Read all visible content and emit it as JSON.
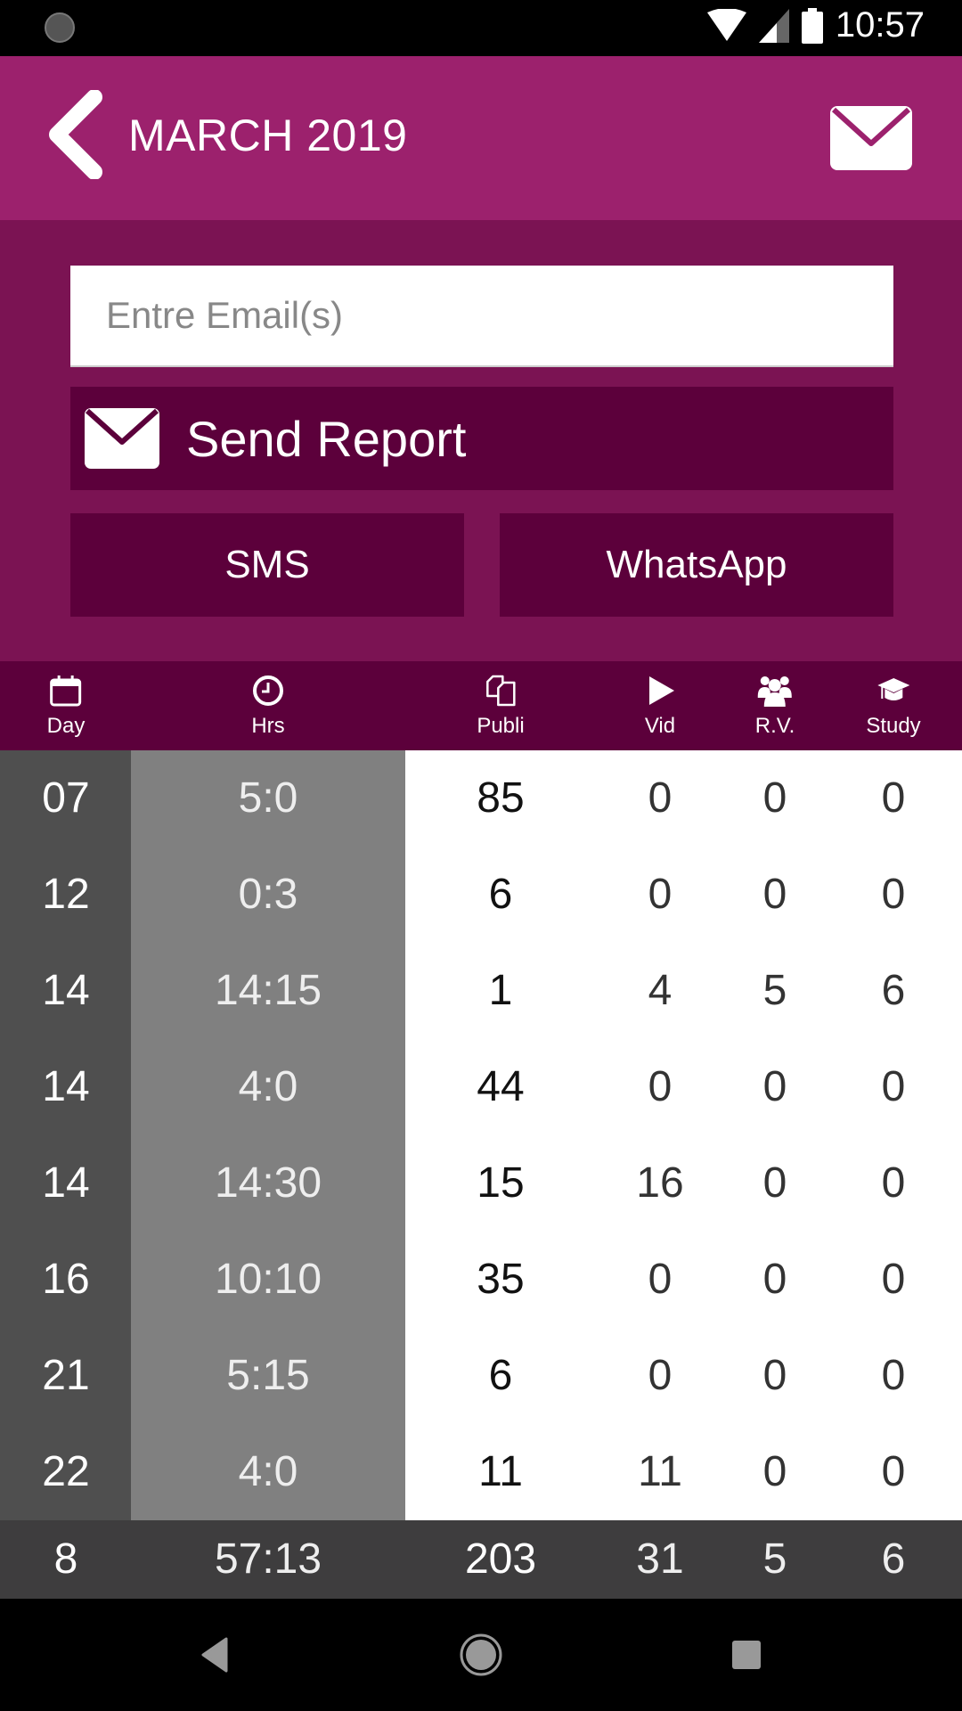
{
  "status_bar": {
    "time": "10:57"
  },
  "header": {
    "title": "MARCH 2019"
  },
  "report": {
    "email_placeholder": "Entre Email(s)",
    "email_value": "",
    "send_label": "Send Report",
    "sms_label": "SMS",
    "whatsapp_label": "WhatsApp"
  },
  "colors": {
    "appbar": "#9c216d",
    "panel": "#7b1353",
    "button": "#5c003b"
  },
  "table": {
    "columns": [
      {
        "key": "day",
        "label": "Day",
        "icon": "calendar-icon"
      },
      {
        "key": "hrs",
        "label": "Hrs",
        "icon": "clock-icon"
      },
      {
        "key": "publi",
        "label": "Publi",
        "icon": "documents-icon"
      },
      {
        "key": "vid",
        "label": "Vid",
        "icon": "play-icon"
      },
      {
        "key": "rv",
        "label": "R.V.",
        "icon": "people-icon"
      },
      {
        "key": "study",
        "label": "Study",
        "icon": "graduation-cap-icon"
      }
    ],
    "rows": [
      {
        "day": "07",
        "hrs": "5:0",
        "publi": "85",
        "vid": "0",
        "rv": "0",
        "study": "0"
      },
      {
        "day": "12",
        "hrs": "0:3",
        "publi": "6",
        "vid": "0",
        "rv": "0",
        "study": "0"
      },
      {
        "day": "14",
        "hrs": "14:15",
        "publi": "1",
        "vid": "4",
        "rv": "5",
        "study": "6"
      },
      {
        "day": "14",
        "hrs": "4:0",
        "publi": "44",
        "vid": "0",
        "rv": "0",
        "study": "0"
      },
      {
        "day": "14",
        "hrs": "14:30",
        "publi": "15",
        "vid": "16",
        "rv": "0",
        "study": "0"
      },
      {
        "day": "16",
        "hrs": "10:10",
        "publi": "35",
        "vid": "0",
        "rv": "0",
        "study": "0"
      },
      {
        "day": "21",
        "hrs": "5:15",
        "publi": "6",
        "vid": "0",
        "rv": "0",
        "study": "0"
      },
      {
        "day": "22",
        "hrs": "4:0",
        "publi": "11",
        "vid": "11",
        "rv": "0",
        "study": "0"
      }
    ],
    "totals": {
      "day": "8",
      "hrs": "57:13",
      "publi": "203",
      "vid": "31",
      "rv": "5",
      "study": "6"
    }
  }
}
